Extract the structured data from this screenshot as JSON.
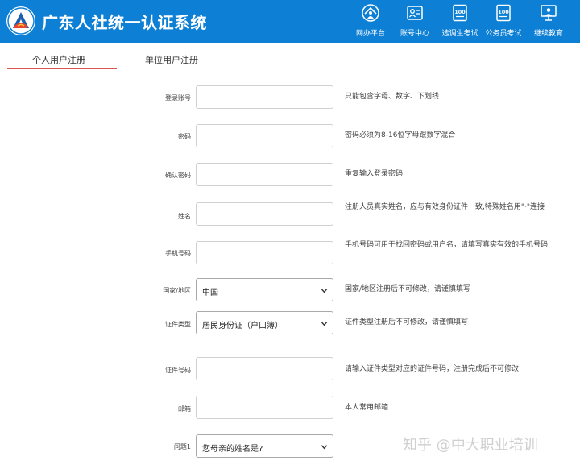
{
  "header": {
    "title": "广东人社统一认证系统",
    "bg_color": "#0d7fd4",
    "nav": [
      {
        "label": "网办平台",
        "icon": "house-person-icon"
      },
      {
        "label": "账号中心",
        "icon": "account-card-icon"
      },
      {
        "label": "选调生考试",
        "icon": "exam-100-icon"
      },
      {
        "label": "公务员考试",
        "icon": "exam-100-icon"
      },
      {
        "label": "继续教育",
        "icon": "teacher-board-icon"
      }
    ]
  },
  "tabs": [
    {
      "label": "个人用户注册",
      "active": true
    },
    {
      "label": "单位用户注册",
      "active": false
    }
  ],
  "form": {
    "rows": [
      {
        "label": "登录账号",
        "type": "input",
        "value": "",
        "hint": "只能包含字母、数字、下划线"
      },
      {
        "label": "密码",
        "type": "input",
        "value": "",
        "hint": "密码必须为8-16位字母跟数字混合"
      },
      {
        "label": "确认密码",
        "type": "input",
        "value": "",
        "hint": "重复输入登录密码"
      },
      {
        "label": "姓名",
        "type": "input",
        "value": "",
        "hint": "注册人员真实姓名，应与有效身份证件一致,特殊姓名用\"·\"连接"
      },
      {
        "label": "手机号码",
        "type": "input",
        "value": "",
        "hint": "手机号码可用于找回密码或用户名，请填写真实有效的手机号码"
      },
      {
        "label": "国家/地区",
        "type": "select",
        "value": "中国",
        "hint": "国家/地区注册后不可修改，请谨慎填写"
      },
      {
        "label": "证件类型",
        "type": "select",
        "value": "居民身份证（户口簿）",
        "hint": "证件类型注册后不可修改，请谨慎填写"
      },
      {
        "label": "证件号码",
        "type": "input",
        "value": "",
        "hint": "请输入证件类型对应的证件号码，注册完成后不可修改"
      },
      {
        "label": "邮箱",
        "type": "input",
        "value": "",
        "hint": "本人常用邮箱"
      },
      {
        "label": "问题1",
        "type": "select",
        "value": "您母亲的姓名是?",
        "hint": ""
      }
    ]
  },
  "watermark": "知乎 @中大职业培训",
  "colors": {
    "accent_underline": "#d9534f"
  }
}
